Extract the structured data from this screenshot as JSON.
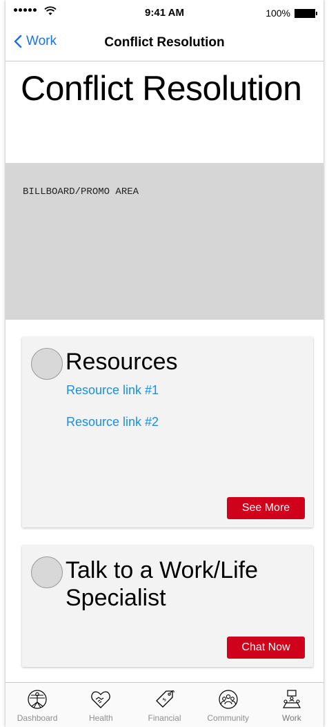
{
  "status_bar": {
    "time": "9:41 AM",
    "battery": "100%"
  },
  "nav": {
    "back_label": "Work",
    "title": "Conflict Resolution"
  },
  "page": {
    "title": "Conflict Resolution"
  },
  "billboard": {
    "label": "BILLBOARD/PROMO AREA"
  },
  "resources_card": {
    "title": "Resources",
    "links": [
      "Resource link #1",
      "Resource link #2"
    ],
    "button": "See More"
  },
  "talk_card": {
    "title": "Talk to a Work/Life Specialist",
    "button": "Chat Now"
  },
  "tab_bar": {
    "items": [
      {
        "label": "Dashboard",
        "icon": "vitruvian-man-icon"
      },
      {
        "label": "Health",
        "icon": "heart-handshake-icon"
      },
      {
        "label": "Financial",
        "icon": "price-tag-icon"
      },
      {
        "label": "Community",
        "icon": "people-circle-icon"
      },
      {
        "label": "Work",
        "icon": "meeting-table-icon"
      }
    ],
    "active": "Work"
  },
  "colors": {
    "accent": "#1a8ee0",
    "button": "#d0021b",
    "billboard": "#d6d6d6",
    "card": "#f3f3f3"
  }
}
